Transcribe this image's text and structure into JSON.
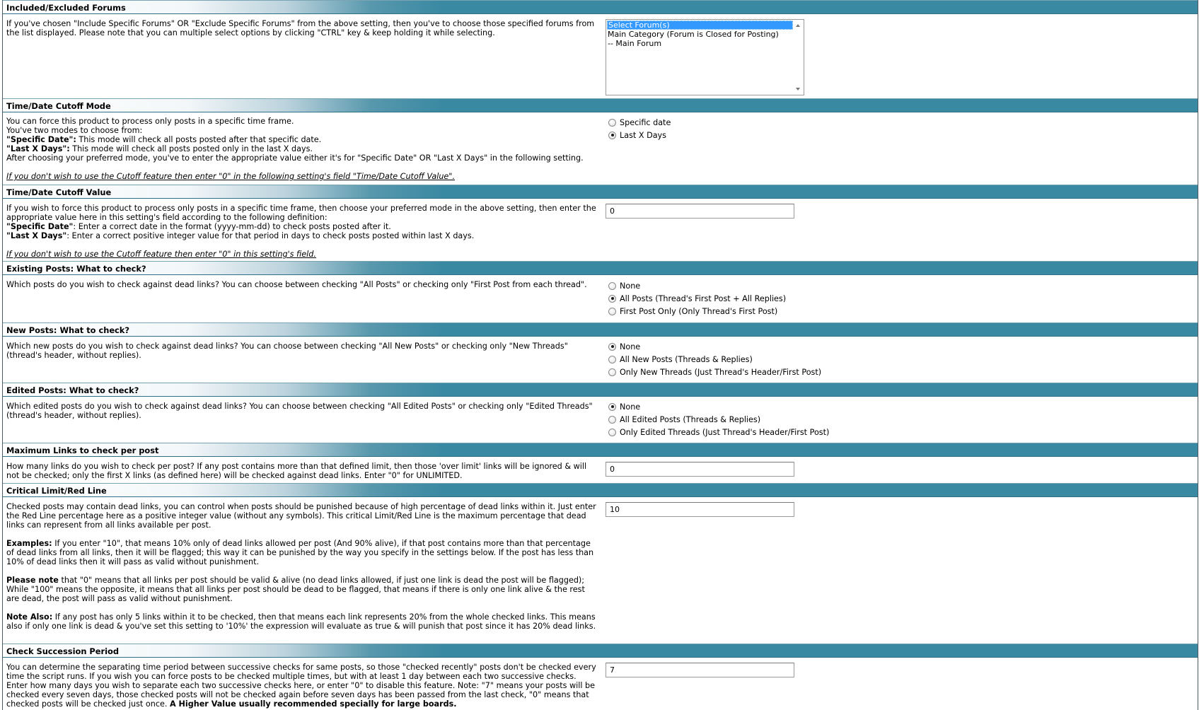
{
  "sections": {
    "forums": {
      "title": "Included/Excluded Forums",
      "desc": "If you've chosen \"Include Specific Forums\" OR \"Exclude Specific Forums\" from the above setting, then you've to choose those specified forums from the list displayed. Please note that you can multiple select options by clicking \"CTRL\" key & keep holding it while selecting.",
      "options": [
        "Select Forum(s)",
        "Main Category (Forum is Closed for Posting)",
        "-- Main Forum"
      ]
    },
    "cutoff_mode": {
      "title": "Time/Date Cutoff Mode",
      "line1": "You can force this product to process only posts in a specific time frame.",
      "line2": "You've two modes to choose from:",
      "line3_b": "\"Specific Date\":",
      "line3": " This mode will check all posts posted after that specific date.",
      "line4_b": "\"Last X Days\":",
      "line4": " This mode will check all posts posted only in the last X days.",
      "line5": "After choosing your preferred mode, you've to enter the appropriate value either it's for \"Specific Date\" OR \"Last X Days\" in the following setting.",
      "note": "If you don't wish to use the Cutoff feature then enter \"0\" in the following setting's field \"Time/Date Cutoff Value\".",
      "radio1": "Specific date",
      "radio2": "Last X Days"
    },
    "cutoff_value": {
      "title": "Time/Date Cutoff Value",
      "line1": "If you wish to force this product to process only posts in a specific time frame, then choose your preferred mode in the above setting, then enter the appropriate value here in this setting's field according to the following definition:",
      "line2_b": "\"Specific Date\"",
      "line2": ": Enter a correct date in the format (yyyy-mm-dd) to check posts posted after it.",
      "line3_b": "\"Last X Days\"",
      "line3": ": Enter a correct positive integer value for that period in days to check posts posted within last X days.",
      "note": "If you don't wish to use the Cutoff feature then enter \"0\" in this setting's field.",
      "value": "0"
    },
    "existing": {
      "title": "Existing Posts: What to check?",
      "desc": "Which posts do you wish to check against dead links? You can choose between checking \"All Posts\" or checking only \"First Post from each thread\".",
      "radio1": "None",
      "radio2": "All Posts (Thread's First Post + All Replies)",
      "radio3": "First Post Only (Only Thread's First Post)"
    },
    "newposts": {
      "title": "New Posts: What to check?",
      "desc": "Which new posts do you wish to check against dead links? You can choose between checking \"All New Posts\" or checking only \"New Threads\" (thread's header, without replies).",
      "radio1": "None",
      "radio2": "All New Posts (Threads & Replies)",
      "radio3": "Only New Threads (Just Thread's Header/First Post)"
    },
    "edited": {
      "title": "Edited Posts: What to check?",
      "desc": "Which edited posts do you wish to check against dead links? You can choose between checking \"All Edited Posts\" or checking only \"Edited Threads\" (thread's header, without replies).",
      "radio1": "None",
      "radio2": "All Edited Posts (Threads & Replies)",
      "radio3": "Only Edited Threads (Just Thread's Header/First Post)"
    },
    "maxlinks": {
      "title": "Maximum Links to check per post",
      "desc": "How many links do you wish to check per post? If any post contains more than that defined limit, then those 'over limit' links will be ignored & will not be checked; only the first X links (as defined here) will be checked against dead links. Enter \"0\" for UNLIMITED.",
      "value": "0"
    },
    "critical": {
      "title": "Critical Limit/Red Line",
      "p1": "Checked posts may contain dead links, you can control when posts should be punished because of high percentage of dead links within it. Just enter the Red Line percentage here as a positive integer value (without any symbols). This critical Limit/Red Line is the maximum percentage that dead links can represent from all links available per post.",
      "p2_b": "Examples:",
      "p2": " If you enter \"10\", that means 10% only of dead links allowed per post (And 90% alive), if that post contains more than that percentage of dead links from all links, then it will be flagged; this way it can be punished by the way you specify in the settings below. If the post has less than 10% of dead links then it will pass as valid without punishment.",
      "p3_b": "Please note",
      "p3": " that \"0\" means that all links per post should be valid & alive (no dead links allowed, if just one link is dead the post will be flagged); While \"100\" means the opposite, it means that all links per post should be dead to be flagged, that means if there is only one link alive & the rest are dead, the post will pass as valid without punishment.",
      "p4_b": "Note Also:",
      "p4": " If any post has only 5 links within it to be checked, then that means each link represents 20% from the whole checked links. This means also if only one link is dead & you've set this setting to '10%' the expression will evaluate as true & will punish that post since it has 20% dead links.",
      "value": "10"
    },
    "succession": {
      "title": "Check Succession Period",
      "desc": "You can determine the separating time period between successive checks for same posts, so those \"checked recently\" posts don't be checked every time the script runs. If you wish you can force posts to be checked multiple times, but with at least 1 day between each two successive checks. Enter how many days you wish to separate each two successive checks here, or enter \"0\" to disable this feature. Note: \"7\" means your posts will be checked every seven days, those checked posts will not be checked again before seven days has been passed from the last check, \"0\" means that checked posts will be checked just once. ",
      "desc_b": "A Higher Value usually recommended specially for large boards.",
      "value": "7"
    }
  }
}
